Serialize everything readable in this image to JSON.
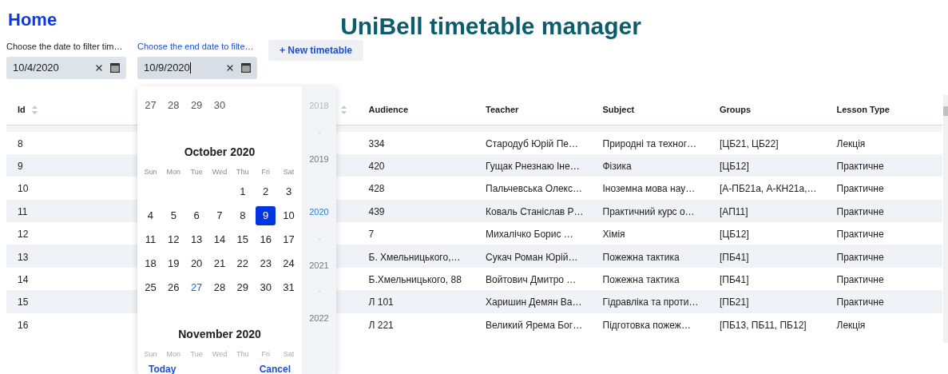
{
  "header": {
    "home_link": "Home",
    "title": "UniBell timetable manager"
  },
  "filters": [
    {
      "label": "Choose the date to filter tim…",
      "value": "10/4/2020",
      "focused": false
    },
    {
      "label": "Choose the end date to filte…",
      "value": "10/9/2020",
      "focused": true
    }
  ],
  "new_button": "+ New timetable",
  "table": {
    "header": {
      "id": {
        "label": "Id",
        "sortable": true
      },
      "column_3": {
        "sortable": true
      },
      "audience": {
        "label": "Audience"
      },
      "teacher": {
        "label": "Teacher"
      },
      "subject": {
        "label": "Subject"
      },
      "groups": {
        "label": "Groups"
      },
      "lesson_type": {
        "label": "Lesson Type"
      }
    },
    "rows": [
      {
        "id": "8",
        "audience": "334",
        "teacher": "Стародуб Юрій Пе…",
        "subject": "Природні та техног…",
        "groups": "[ЦБ21, ЦБ22]",
        "lesson_type": "Лекція"
      },
      {
        "id": "9",
        "audience": "420",
        "teacher": "Гущак Рнезнаю Іне…",
        "subject": "Фізика",
        "groups": "[ЦБ12]",
        "lesson_type": "Практичне"
      },
      {
        "id": "10",
        "audience": "428",
        "teacher": "Пальчевська Олекс…",
        "subject": "Іноземна мова нау…",
        "groups": "[А-ПБ21а, А-КН21а,…",
        "lesson_type": "Практичне"
      },
      {
        "id": "11",
        "audience": "439",
        "teacher": "Коваль Станіслав Р…",
        "subject": "Практичний курс о…",
        "groups": "[АП11]",
        "lesson_type": "Практичне"
      },
      {
        "id": "12",
        "audience": "7",
        "teacher": "Михалічко Борис …",
        "subject": "Хімія",
        "groups": "[ЦБ12]",
        "lesson_type": "Практичне"
      },
      {
        "id": "13",
        "audience": "Б. Хмельницького,…",
        "teacher": "Сукач Роман Юрій…",
        "subject": "Пожежна тактика",
        "groups": "[ПБ41]",
        "lesson_type": "Практичне"
      },
      {
        "id": "14",
        "audience": "Б.Хмельницького, 88",
        "teacher": "Войтович Дмитро …",
        "subject": "Пожежна тактика",
        "groups": "[ПБ41]",
        "lesson_type": "Практичне"
      },
      {
        "id": "15",
        "audience": "Л 101",
        "teacher": "Харишин Демян Ва…",
        "subject": "Гідравліка та проти…",
        "groups": "[ПБ21]",
        "lesson_type": "Практичне"
      },
      {
        "id": "16",
        "audience": "Л 221",
        "teacher": "Великий Ярема Бог…",
        "subject": "Підготовка пожеж…",
        "groups": "[ПБ13, ПБ11, ПБ12]",
        "lesson_type": "Лекція"
      }
    ]
  },
  "datepicker": {
    "previous_tail": [
      {
        "day": "27"
      },
      {
        "day": "28"
      },
      {
        "day": "29"
      },
      {
        "day": "30"
      }
    ],
    "month": "October 2020",
    "weekdays": [
      "Sun",
      "Mon",
      "Tue",
      "Wed",
      "Thu",
      "Fri",
      "Sat"
    ],
    "weeks": [
      [
        {
          "kind": "blank"
        },
        {
          "kind": "blank"
        },
        {
          "kind": "blank"
        },
        {
          "kind": "blank"
        },
        {
          "kind": "day",
          "day": "1",
          "selected": false,
          "today": false
        },
        {
          "kind": "day",
          "day": "2",
          "selected": false,
          "today": false
        },
        {
          "kind": "day",
          "day": "3",
          "selected": false,
          "today": false
        }
      ],
      [
        {
          "kind": "day",
          "day": "4",
          "selected": false,
          "today": false
        },
        {
          "kind": "day",
          "day": "5",
          "selected": false,
          "today": false
        },
        {
          "kind": "day",
          "day": "6",
          "selected": false,
          "today": false
        },
        {
          "kind": "day",
          "day": "7",
          "selected": false,
          "today": false
        },
        {
          "kind": "day",
          "day": "8",
          "selected": false,
          "today": false
        },
        {
          "kind": "day",
          "day": "9",
          "selected": true,
          "today": false
        },
        {
          "kind": "day",
          "day": "10",
          "selected": false,
          "today": false
        }
      ],
      [
        {
          "kind": "day",
          "day": "11",
          "selected": false,
          "today": false
        },
        {
          "kind": "day",
          "day": "12",
          "selected": false,
          "today": false
        },
        {
          "kind": "day",
          "day": "13",
          "selected": false,
          "today": false
        },
        {
          "kind": "day",
          "day": "14",
          "selected": false,
          "today": false
        },
        {
          "kind": "day",
          "day": "15",
          "selected": false,
          "today": false
        },
        {
          "kind": "day",
          "day": "16",
          "selected": false,
          "today": false
        },
        {
          "kind": "day",
          "day": "17",
          "selected": false,
          "today": false
        }
      ],
      [
        {
          "kind": "day",
          "day": "18",
          "selected": false,
          "today": false
        },
        {
          "kind": "day",
          "day": "19",
          "selected": false,
          "today": false
        },
        {
          "kind": "day",
          "day": "20",
          "selected": false,
          "today": false
        },
        {
          "kind": "day",
          "day": "21",
          "selected": false,
          "today": false
        },
        {
          "kind": "day",
          "day": "22",
          "selected": false,
          "today": false
        },
        {
          "kind": "day",
          "day": "23",
          "selected": false,
          "today": false
        },
        {
          "kind": "day",
          "day": "24",
          "selected": false,
          "today": false
        }
      ],
      [
        {
          "kind": "day",
          "day": "25",
          "selected": false,
          "today": false
        },
        {
          "kind": "day",
          "day": "26",
          "selected": false,
          "today": false
        },
        {
          "kind": "day",
          "day": "27",
          "selected": false,
          "today": true
        },
        {
          "kind": "day",
          "day": "28",
          "selected": false,
          "today": false
        },
        {
          "kind": "day",
          "day": "29",
          "selected": false,
          "today": false
        },
        {
          "kind": "day",
          "day": "30",
          "selected": false,
          "today": false
        },
        {
          "kind": "day",
          "day": "31",
          "selected": false,
          "today": false
        }
      ]
    ],
    "next_month": "November 2020",
    "next_weekdays": [
      "Sun",
      "Mon",
      "Tue",
      "Wed",
      "Thu",
      "Fri",
      "Sat"
    ],
    "years": [
      {
        "label": "2018",
        "selected": false,
        "faded": true
      },
      {
        "label": "2019",
        "selected": false,
        "faded": false
      },
      {
        "label": "2020",
        "selected": true,
        "faded": false
      },
      {
        "label": "2021",
        "selected": false,
        "faded": false
      },
      {
        "label": "2022",
        "selected": false,
        "faded": false
      }
    ],
    "today_button": "Today",
    "cancel_button": "Cancel"
  }
}
